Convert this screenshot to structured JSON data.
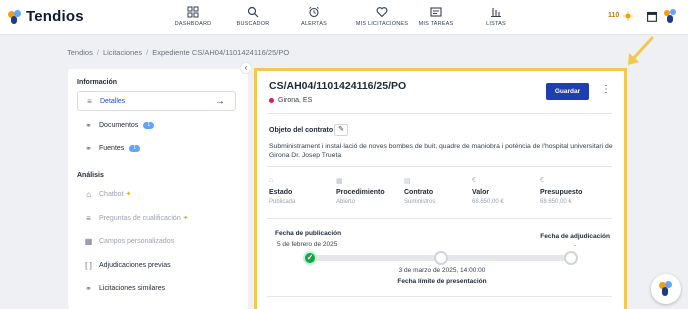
{
  "app": {
    "name": "Tendios"
  },
  "nav": [
    {
      "label": "DASHBOARD",
      "icon": "dashboard-icon"
    },
    {
      "label": "BUSCADOR",
      "icon": "search-icon"
    },
    {
      "label": "ALERTAS",
      "icon": "alarm-clock-icon"
    },
    {
      "label": "MIS LICITACIONES",
      "icon": "heart-icon"
    },
    {
      "label": "MIS TAREAS",
      "icon": "tasks-icon"
    },
    {
      "label": "LISTAS",
      "icon": "lists-icon"
    }
  ],
  "header_right": {
    "credits": "110"
  },
  "breadcrumb": [
    "Tendios",
    "Licitaciones",
    "Expediente CS/AH04/1101424116/25/PO"
  ],
  "sidebar": {
    "informacion_title": "Información",
    "analisis_title": "Análisis",
    "items": [
      {
        "label": "Detalles",
        "icon": "list-icon"
      },
      {
        "label": "Documentos",
        "icon": "link-icon",
        "badge": "1"
      },
      {
        "label": "Fuentes",
        "icon": "link-icon",
        "badge": "1"
      },
      {
        "label": "Chatbot",
        "icon": "bank-icon"
      },
      {
        "label": "Preguntas de cualificación",
        "icon": "list-icon"
      },
      {
        "label": "Campos personalizados",
        "icon": "grid-icon"
      },
      {
        "label": "Adjudicaciones previas",
        "icon": "brackets-icon"
      },
      {
        "label": "Licitaciones similares",
        "icon": "link-icon"
      }
    ]
  },
  "card": {
    "title": "CS/AH04/1101424116/25/PO",
    "location": "Girona, ES",
    "save_label": "Guardar",
    "object_label": "Objeto del contrato",
    "object_text": "Subministrament i instal·lació de noves bombes de buit, quadre de maniobra i potència de l'hospital universitari de Girona Dr. Josep Trueta",
    "stats": [
      {
        "label": "Estado",
        "value": "Publicada",
        "icon": "bank-icon"
      },
      {
        "label": "Procedimiento",
        "value": "Abierto",
        "icon": "grid-icon"
      },
      {
        "label": "Contrato",
        "value": "Suministros",
        "icon": "document-icon"
      },
      {
        "label": "Valor",
        "value": "68.650,00 €",
        "icon": "euro-icon"
      },
      {
        "label": "Presupuesto",
        "value": "68.650,00 €",
        "icon": "euro-icon"
      }
    ],
    "timeline": {
      "pub_label": "Fecha de publicación",
      "pub_date": "5 de febrero de 2025",
      "adj_label": "Fecha de adjudicación",
      "adj_date": "-",
      "mid_date": "3 de marzo de 2025, 14:00:00",
      "mid_label": "Fecha límite de presentación"
    }
  },
  "colors": {
    "accent": "#1e40af",
    "highlight_border": "#f2c94c",
    "success": "#16a34a"
  }
}
